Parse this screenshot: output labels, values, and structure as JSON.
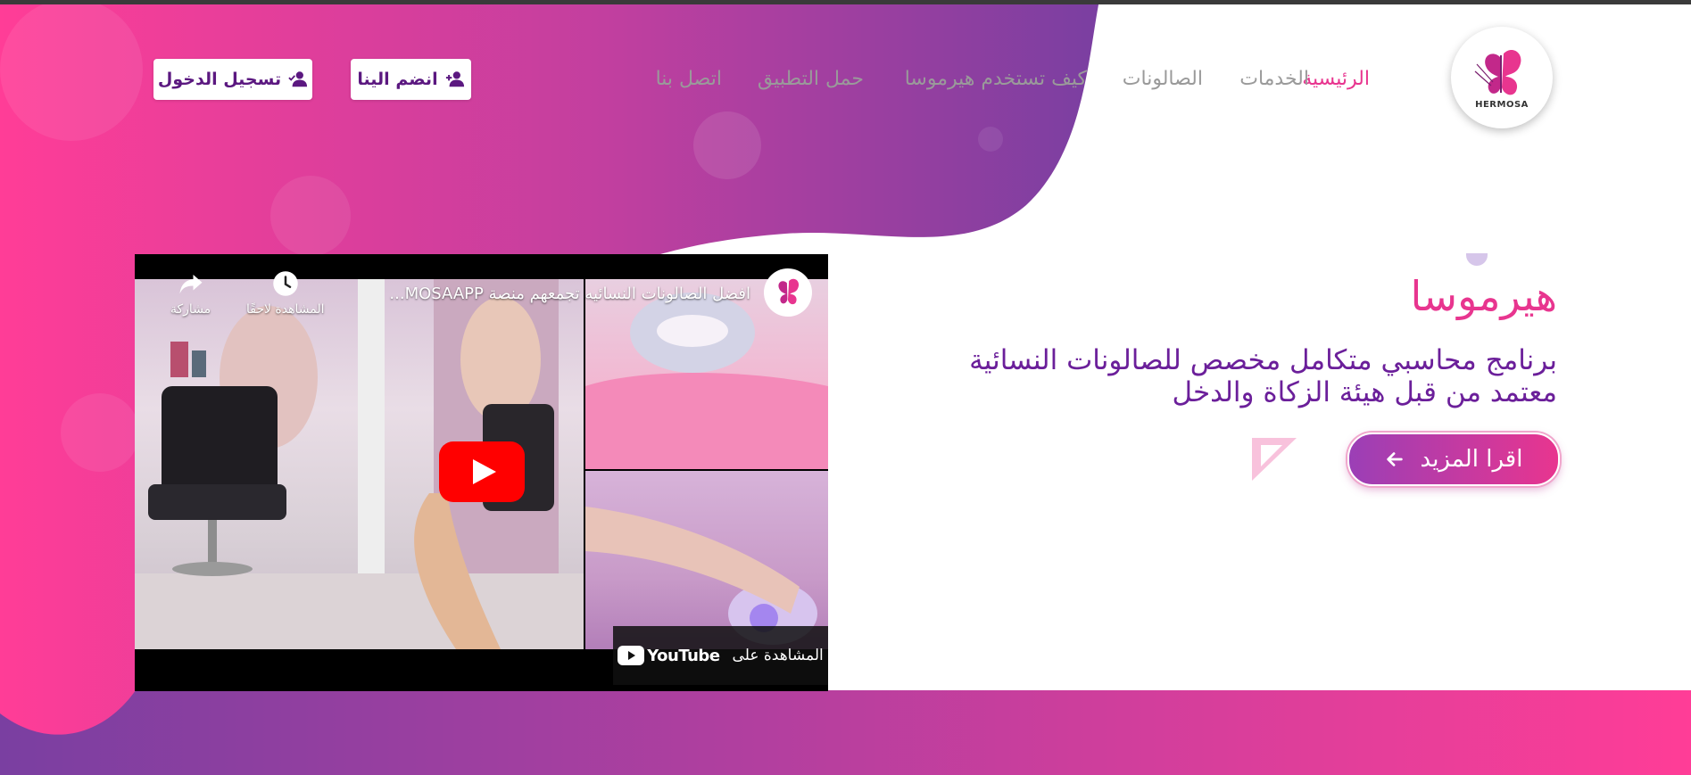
{
  "brand": {
    "logo_text": "HERMOSA",
    "accent": "#e8358f",
    "purple": "#6b1f9a"
  },
  "nav": {
    "items": [
      {
        "label": "الرئيسية",
        "active": true
      },
      {
        "label": "الخدمات",
        "active": false
      },
      {
        "label": "الصالونات",
        "active": false
      },
      {
        "label": "كيف تستخدم هيرموسا",
        "active": false
      },
      {
        "label": "حمل التطبيق",
        "active": false
      },
      {
        "label": "اتصل بنا",
        "active": false
      }
    ],
    "join_label": "انضم الينا",
    "login_label": "تسجيل الدخول"
  },
  "hero": {
    "title": "هيرموسا",
    "subtitle_line1": "برنامج محاسبي متكامل مخصص للصالونات النسائية",
    "subtitle_line2": "معتمد من قبل هيئة الزكاة والدخل",
    "read_more_label": "اقرا المزيد"
  },
  "video": {
    "title": "افضل الصالونات النسائيه تجمعهم منصة MOSAAPP...",
    "watch_later_label": "المشاهدة لاحقًا",
    "share_label": "مشاركة",
    "watch_on_label": "المشاهدة على",
    "youtube_label": "YouTube",
    "channel_logo_text": "HERMOSA"
  },
  "icons": {
    "join": "user-plus-icon",
    "login": "user-check-icon",
    "read_more": "arrow-left-icon",
    "watch_later": "clock-icon",
    "share": "share-icon",
    "play": "play-icon"
  }
}
